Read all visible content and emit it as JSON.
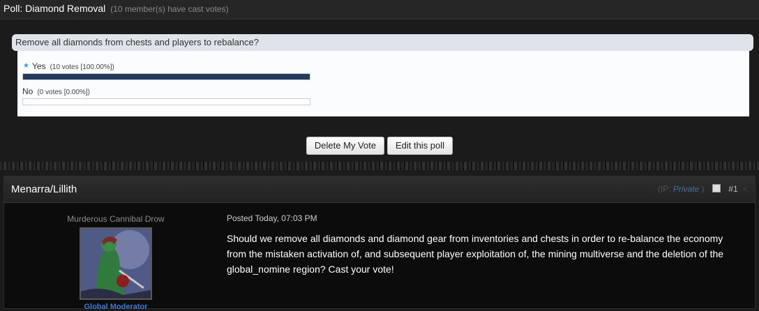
{
  "poll": {
    "title": "Poll: Diamond Removal",
    "members_note": "(10 member(s) have cast votes)",
    "question": "Remove all diamonds from chests and players to rebalance?",
    "choices": [
      {
        "label": "Yes",
        "votes": "(10 votes [100.00%])",
        "percent": 100,
        "my_vote": true
      },
      {
        "label": "No",
        "votes": "(0 votes [0.00%])",
        "percent": 0,
        "my_vote": false
      }
    ],
    "delete_vote_label": "Delete My Vote",
    "edit_poll_label": "Edit this poll"
  },
  "post": {
    "author": "Menarra/Lillith",
    "ip_prefix": "(IP: ",
    "ip_value": "Private",
    "ip_suffix": " )",
    "post_number": "#1",
    "user_title": "Murderous Cannibal Drow",
    "user_group": "Global Moderator",
    "date": "Posted Today, 07:03 PM",
    "body": "Should we remove all diamonds and diamond gear from inventories and chests in order to re-balance the economy from the mistaken activation of, and subsequent player exploitation of, the mining multiverse and the deletion of the global_nomine region?  Cast your vote!"
  },
  "colors": {
    "accent": "#243b5c",
    "group_link": "#3a7bd5",
    "background": "#1b1b1b"
  }
}
